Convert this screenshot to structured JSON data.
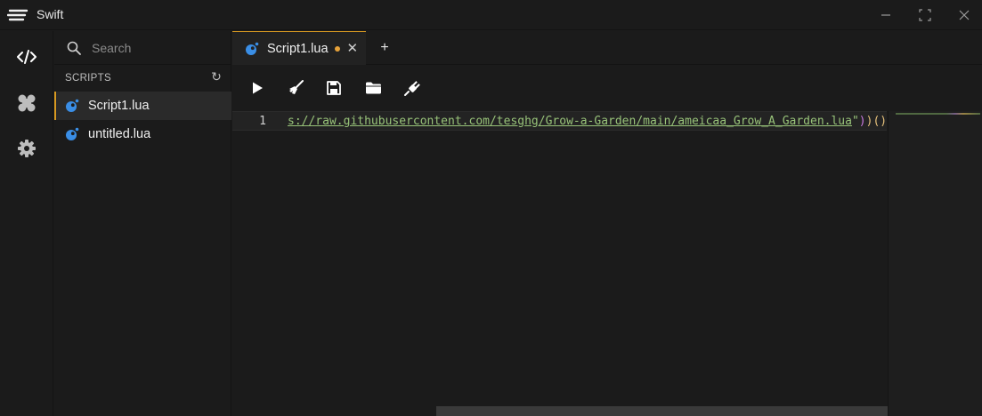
{
  "window": {
    "title": "Swift",
    "controls": [
      "minimize-icon",
      "maximize-icon",
      "close-icon"
    ]
  },
  "activity_bar": {
    "items": [
      {
        "icon": "code-icon",
        "active": true
      },
      {
        "icon": "apps-icon",
        "active": false
      },
      {
        "icon": "gear-icon",
        "active": false
      }
    ]
  },
  "sidebar": {
    "search": {
      "placeholder": "Search",
      "value": ""
    },
    "section_title": "SCRIPTS",
    "refresh_glyph": "↻",
    "files": [
      {
        "name": "Script1.lua",
        "active": true,
        "icon": "lua-file-icon"
      },
      {
        "name": "untitled.lua",
        "active": false,
        "icon": "lua-file-icon"
      }
    ]
  },
  "tabs": {
    "items": [
      {
        "label": "Script1.lua",
        "modified": true,
        "close_glyph": "✕"
      }
    ],
    "add_glyph": "+"
  },
  "toolbar": {
    "tools": [
      "play-icon",
      "broom-icon",
      "save-icon",
      "folder-icon",
      "plug-icon"
    ]
  },
  "editor": {
    "lines": [
      {
        "number": "1",
        "url_fragment": "s://raw.githubusercontent.com/tesghg/Grow-a-Garden/main/ameicaa_Grow_A_Garden.lua",
        "quote": "\"",
        "paren_close_1": ")",
        "paren_close_2": ")",
        "call": "()"
      }
    ]
  },
  "colors": {
    "background": "#1b1b1b",
    "accent": "#d79921",
    "modified_dot": "#e7a23a",
    "string": "#98c379",
    "lua_icon": "#3a8ee6"
  }
}
